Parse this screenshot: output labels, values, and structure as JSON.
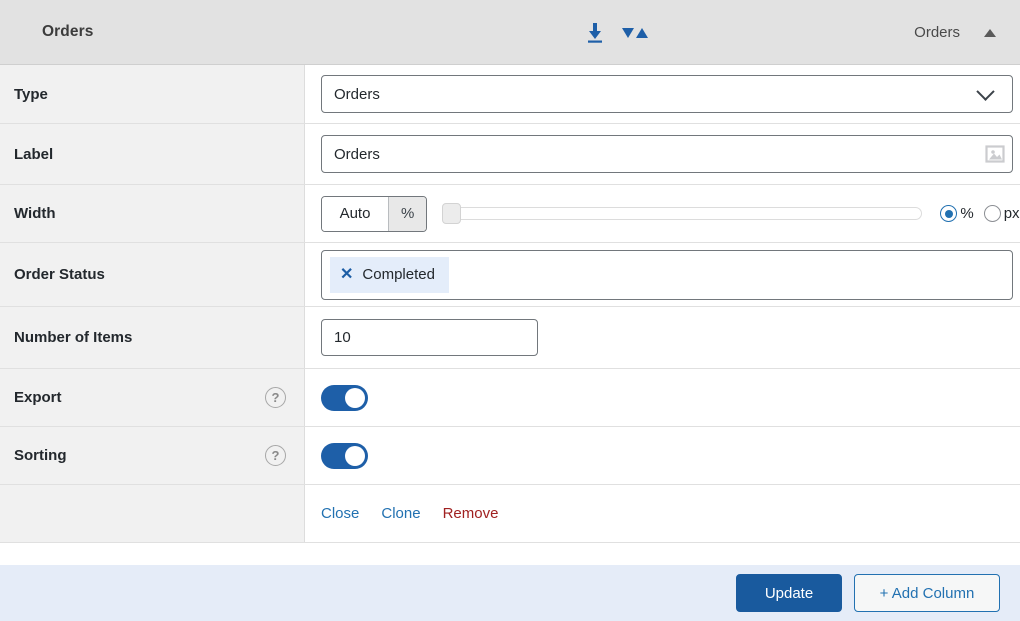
{
  "header": {
    "title": "Orders",
    "export_icon": "download-icon",
    "sort_icon": "sort-updown-icon",
    "right_label": "Orders",
    "collapse_icon": "caret-up-icon"
  },
  "rows": {
    "type": {
      "label": "Type",
      "value": "Orders",
      "chevron_icon": "chevron-down-icon"
    },
    "label": {
      "label": "Label",
      "value": "Orders",
      "media_icon": "image-icon"
    },
    "width": {
      "label": "Width",
      "auto_value": "Auto",
      "unit_suffix": "%",
      "slider_position": 0,
      "radio_percent": "%",
      "radio_px": "px",
      "selected_unit": "%"
    },
    "order_status": {
      "label": "Order Status",
      "chips": [
        {
          "text": "Completed",
          "remove_icon": "close-icon"
        }
      ]
    },
    "number_of_items": {
      "label": "Number of Items",
      "value": "10"
    },
    "export": {
      "label": "Export",
      "help_icon": "question-mark-icon",
      "help_glyph": "?",
      "toggle_state": "on"
    },
    "sorting": {
      "label": "Sorting",
      "help_icon": "question-mark-icon",
      "help_glyph": "?",
      "toggle_state": "on"
    },
    "actions": {
      "close": "Close",
      "clone": "Clone",
      "remove": "Remove"
    }
  },
  "footer": {
    "update_label": "Update",
    "add_column_label": "+ Add Column"
  },
  "colors": {
    "accent_blue": "#2271b1",
    "primary_button": "#195a9e",
    "toggle_on": "#1e5fa8",
    "remove_red": "#a02121",
    "chip_background": "#e4edfa",
    "footer_background": "#e5ecf8",
    "header_background": "#e2e2e2",
    "label_column_background": "#f1f1f1"
  }
}
